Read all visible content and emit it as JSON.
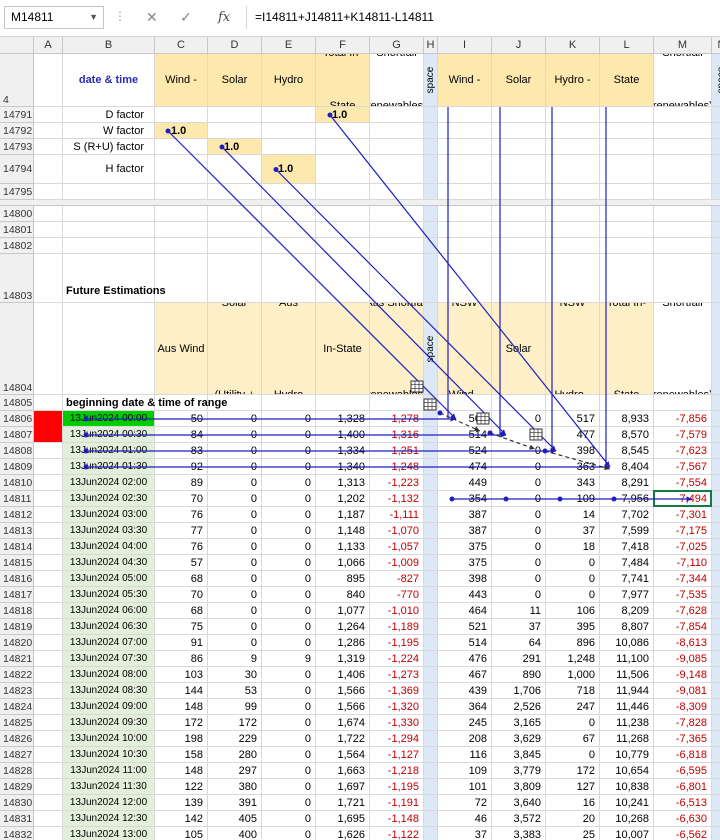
{
  "namebox": "M14811",
  "formula": "=I14811+J14811+K14811-L14811",
  "columns": [
    "A",
    "B",
    "C",
    "D",
    "E",
    "F",
    "G",
    "H",
    "I",
    "J",
    "K",
    "L",
    "M",
    "N"
  ],
  "header_row": {
    "rownum": "4",
    "B": "date & time",
    "C": "S. Aus Wind - MW",
    "D": "S. Aus Total Solar (Utility + Rooftop):",
    "E": "S. Aus Hydro [zero]",
    "F": "S. Aus Total In-State Demand:",
    "G": "S. Aus Shortfall (renewables): MW",
    "H": "space",
    "I": "NSW Wind - MW",
    "J": "NSW Total Solar (Utility + Rooftop):",
    "K": "NSW Hydro - MW",
    "L": "NSW Total In-State Demand: MW",
    "M": "NSW Shortfall (renewables): MW",
    "N": "space"
  },
  "factors": [
    {
      "row": "14791",
      "label": "D factor",
      "col": "F",
      "value": "1.0"
    },
    {
      "row": "14792",
      "label": "W factor",
      "col": "C",
      "value": "1.0"
    },
    {
      "row": "14793",
      "label": "S (R+U) factor",
      "col": "D",
      "value": "1.0"
    },
    {
      "row": "14794",
      "label": "H factor",
      "col": "E",
      "value": "1.0"
    }
  ],
  "empty_rows": [
    "14795",
    "14800",
    "14801",
    "14802"
  ],
  "section": {
    "row": "14803",
    "label": "Future Estimations"
  },
  "future_header": {
    "row": "14804",
    "C": "Future S. Aus Wind - MW",
    "D": "Future S. Aus Total Solar (Utility + Rooftop): MW",
    "E": "Future S. Aus Hydro [zero]",
    "F": "Future S. Aus Total In-State Demand: MW",
    "G": "Future S. Aus Shortfall (renewables): MW",
    "H": "space",
    "I": "Future NSW Wind - MW",
    "J": "Future NSW Total Solar (Utility + Rooftop): MW",
    "K": "Future NSW Hydro - MW",
    "L": "Future NSW Total In-State Demand: MW",
    "M": "Future NSW Shortfall (renewables): MW"
  },
  "range_label": {
    "row": "14805",
    "label": "beginning date & time of range"
  },
  "data_rows": [
    [
      "14806",
      "13Jun2024 00:00",
      "50",
      "0",
      "0",
      "1,328",
      "-1,278",
      "560",
      "0",
      "517",
      "8,933",
      "-7,856"
    ],
    [
      "14807",
      "13Jun2024 00:30",
      "84",
      "0",
      "0",
      "1,400",
      "-1,316",
      "514",
      "0",
      "477",
      "8,570",
      "-7,579"
    ],
    [
      "14808",
      "13Jun2024 01:00",
      "83",
      "0",
      "0",
      "1,334",
      "-1,251",
      "524",
      "0",
      "398",
      "8,545",
      "-7,623"
    ],
    [
      "14809",
      "13Jun2024 01:30",
      "92",
      "0",
      "0",
      "1,340",
      "-1,248",
      "474",
      "0",
      "363",
      "8,404",
      "-7,567"
    ],
    [
      "14810",
      "13Jun2024 02:00",
      "89",
      "0",
      "0",
      "1,313",
      "-1,223",
      "449",
      "0",
      "343",
      "8,291",
      "-7,554"
    ],
    [
      "14811",
      "13Jun2024 02:30",
      "70",
      "0",
      "0",
      "1,202",
      "-1,132",
      "354",
      "0",
      "109",
      "7,956",
      "-7,494"
    ],
    [
      "14812",
      "13Jun2024 03:00",
      "76",
      "0",
      "0",
      "1,187",
      "-1,111",
      "387",
      "0",
      "14",
      "7,702",
      "-7,301"
    ],
    [
      "14813",
      "13Jun2024 03:30",
      "77",
      "0",
      "0",
      "1,148",
      "-1,070",
      "387",
      "0",
      "37",
      "7,599",
      "-7,175"
    ],
    [
      "14814",
      "13Jun2024 04:00",
      "76",
      "0",
      "0",
      "1,133",
      "-1,057",
      "375",
      "0",
      "18",
      "7,418",
      "-7,025"
    ],
    [
      "14815",
      "13Jun2024 04:30",
      "57",
      "0",
      "0",
      "1,066",
      "-1,009",
      "375",
      "0",
      "0",
      "7,484",
      "-7,110"
    ],
    [
      "14816",
      "13Jun2024 05:00",
      "68",
      "0",
      "0",
      "895",
      "-827",
      "398",
      "0",
      "0",
      "7,741",
      "-7,344"
    ],
    [
      "14817",
      "13Jun2024 05:30",
      "70",
      "0",
      "0",
      "840",
      "-770",
      "443",
      "0",
      "0",
      "7,977",
      "-7,535"
    ],
    [
      "14818",
      "13Jun2024 06:00",
      "68",
      "0",
      "0",
      "1,077",
      "-1,010",
      "464",
      "11",
      "106",
      "8,209",
      "-7,628"
    ],
    [
      "14819",
      "13Jun2024 06:30",
      "75",
      "0",
      "0",
      "1,264",
      "-1,189",
      "521",
      "37",
      "395",
      "8,807",
      "-7,854"
    ],
    [
      "14820",
      "13Jun2024 07:00",
      "91",
      "0",
      "0",
      "1,286",
      "-1,195",
      "514",
      "64",
      "896",
      "10,086",
      "-8,613"
    ],
    [
      "14821",
      "13Jun2024 07:30",
      "86",
      "9",
      "9",
      "1,319",
      "-1,224",
      "476",
      "291",
      "1,248",
      "11,100",
      "-9,085"
    ],
    [
      "14822",
      "13Jun2024 08:00",
      "103",
      "30",
      "0",
      "1,406",
      "-1,273",
      "467",
      "890",
      "1,000",
      "11,506",
      "-9,148"
    ],
    [
      "14823",
      "13Jun2024 08:30",
      "144",
      "53",
      "0",
      "1,566",
      "-1,369",
      "439",
      "1,706",
      "718",
      "11,944",
      "-9,081"
    ],
    [
      "14824",
      "13Jun2024 09:00",
      "148",
      "99",
      "0",
      "1,566",
      "-1,320",
      "364",
      "2,526",
      "247",
      "11,446",
      "-8,309"
    ],
    [
      "14825",
      "13Jun2024 09:30",
      "172",
      "172",
      "0",
      "1,674",
      "-1,330",
      "245",
      "3,165",
      "0",
      "11,238",
      "-7,828"
    ],
    [
      "14826",
      "13Jun2024 10:00",
      "198",
      "229",
      "0",
      "1,722",
      "-1,294",
      "208",
      "3,629",
      "67",
      "11,268",
      "-7,365"
    ],
    [
      "14827",
      "13Jun2024 10:30",
      "158",
      "280",
      "0",
      "1,564",
      "-1,127",
      "116",
      "3,845",
      "0",
      "10,779",
      "-6,818"
    ],
    [
      "14828",
      "13Jun2024 11:00",
      "148",
      "297",
      "0",
      "1,663",
      "-1,218",
      "109",
      "3,779",
      "172",
      "10,654",
      "-6,595"
    ],
    [
      "14829",
      "13Jun2024 11:30",
      "122",
      "380",
      "0",
      "1,697",
      "-1,195",
      "101",
      "3,809",
      "127",
      "10,838",
      "-6,801"
    ],
    [
      "14830",
      "13Jun2024 12:00",
      "139",
      "391",
      "0",
      "1,721",
      "-1,191",
      "72",
      "3,640",
      "16",
      "10,241",
      "-6,513"
    ],
    [
      "14831",
      "13Jun2024 12:30",
      "142",
      "405",
      "0",
      "1,695",
      "-1,148",
      "46",
      "3,572",
      "20",
      "10,268",
      "-6,630"
    ],
    [
      "14832",
      "13Jun2024 13:00",
      "105",
      "400",
      "0",
      "1,626",
      "-1,122",
      "37",
      "3,383",
      "25",
      "10,007",
      "-6,562"
    ]
  ],
  "colors": {
    "yellow": "#fde9ad",
    "green_fill": "#e2efda",
    "bright_green": "#00cc00",
    "red_fill": "#ff0000",
    "arrow_blue": "#1f1fbf",
    "negative_red": "#c00000",
    "space_blue": "#dce8f5"
  }
}
